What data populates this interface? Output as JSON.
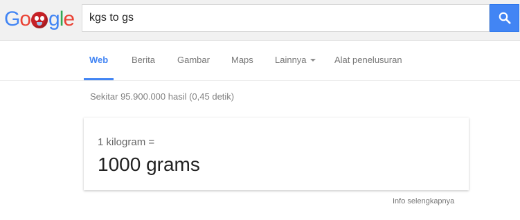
{
  "logo": {
    "prefix": "Go",
    "suffix": "gle",
    "colors": [
      "#4285f4",
      "#ea4335",
      "#fbbc05",
      "#4285f4",
      "#34a853",
      "#ea4335"
    ]
  },
  "search": {
    "query": "kgs to gs",
    "button_icon": "search-icon"
  },
  "tabs": [
    {
      "label": "Web",
      "active": true
    },
    {
      "label": "Berita"
    },
    {
      "label": "Gambar"
    },
    {
      "label": "Maps"
    },
    {
      "label": "Lainnya",
      "has_dropdown": true
    },
    {
      "label": "Alat penelusuran"
    }
  ],
  "result_stats": "Sekitar 95.900.000 hasil (0,45 detik)",
  "answer": {
    "from": "1 kilogram =",
    "result": "1000 grams"
  },
  "more_info": "Info selengkapnya",
  "colors": {
    "accent": "#4285f4",
    "header_bg": "#f1f1f1"
  }
}
